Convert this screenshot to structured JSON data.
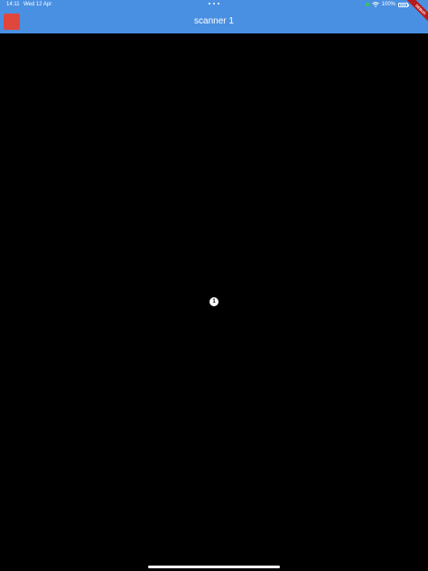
{
  "status_bar": {
    "time": "14:11",
    "date": "Wed 12 Apr",
    "battery_percent": "100%",
    "battery_level": 1.0
  },
  "app_bar": {
    "title": "scanner 1",
    "debug_banner": "DEBUG",
    "background_color": "#4a90e2",
    "menu_button_color": "#e0473c"
  },
  "viewport": {
    "marker_label": "1"
  },
  "colors": {
    "background": "#000000",
    "debug_banner": "#b71c1c"
  }
}
